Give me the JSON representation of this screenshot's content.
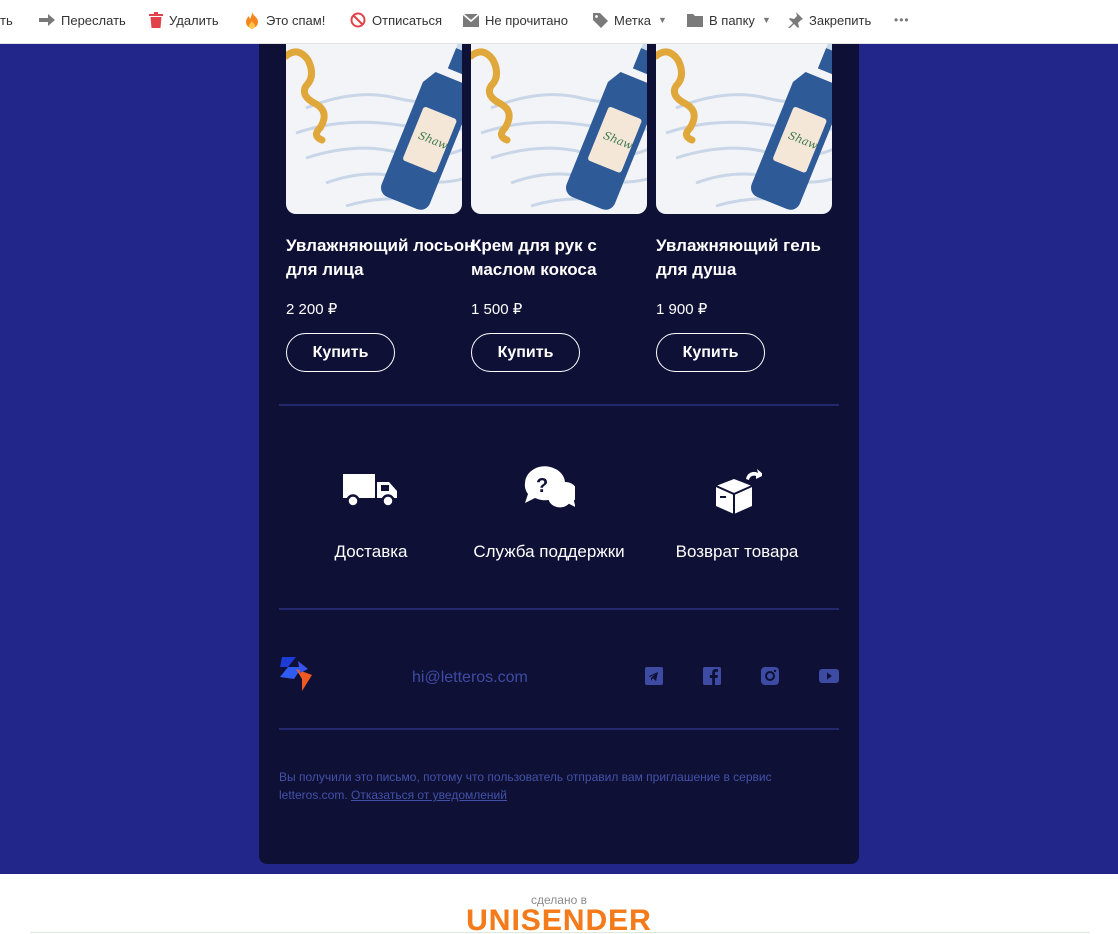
{
  "toolbar": {
    "reply_partial": "ть",
    "forward": "Переслать",
    "delete": "Удалить",
    "spam": "Это спам!",
    "unsubscribe": "Отписаться",
    "unread": "Не прочитано",
    "label": "Метка",
    "to_folder": "В папку",
    "pin": "Закрепить",
    "more": "•••"
  },
  "products": [
    {
      "title": "Увлажняющий лосьон для лица",
      "price": "2 200 ₽",
      "button": "Купить"
    },
    {
      "title": "Крем для рук с маслом кокоса",
      "price": "1 500 ₽",
      "button": "Купить"
    },
    {
      "title": "Увлажняющий гель для душа",
      "price": "1 900 ₽",
      "button": "Купить"
    }
  ],
  "services": [
    {
      "label": "Доставка",
      "icon": "truck-icon"
    },
    {
      "label": "Служба поддержки",
      "icon": "chat-question-icon"
    },
    {
      "label": "Возврат товара",
      "icon": "box-return-icon"
    }
  ],
  "footer": {
    "email": "hi@letteros.com",
    "socials": [
      "telegram-icon",
      "facebook-icon",
      "instagram-icon",
      "youtube-icon"
    ],
    "disclaimer_text": "Вы получили это письмо, потому что пользователь отправил вам приглашение в сервис letteros.com.",
    "unsubscribe_link": "Отказаться от уведомлений"
  },
  "madein": {
    "text": "сделано в",
    "brand": "UNISENDER"
  },
  "colors": {
    "page_bg": "#22258a",
    "card_bg": "#0f1036",
    "divider": "#23286e",
    "muted_text": "#4352a8",
    "brand_orange": "#f37b1c"
  }
}
